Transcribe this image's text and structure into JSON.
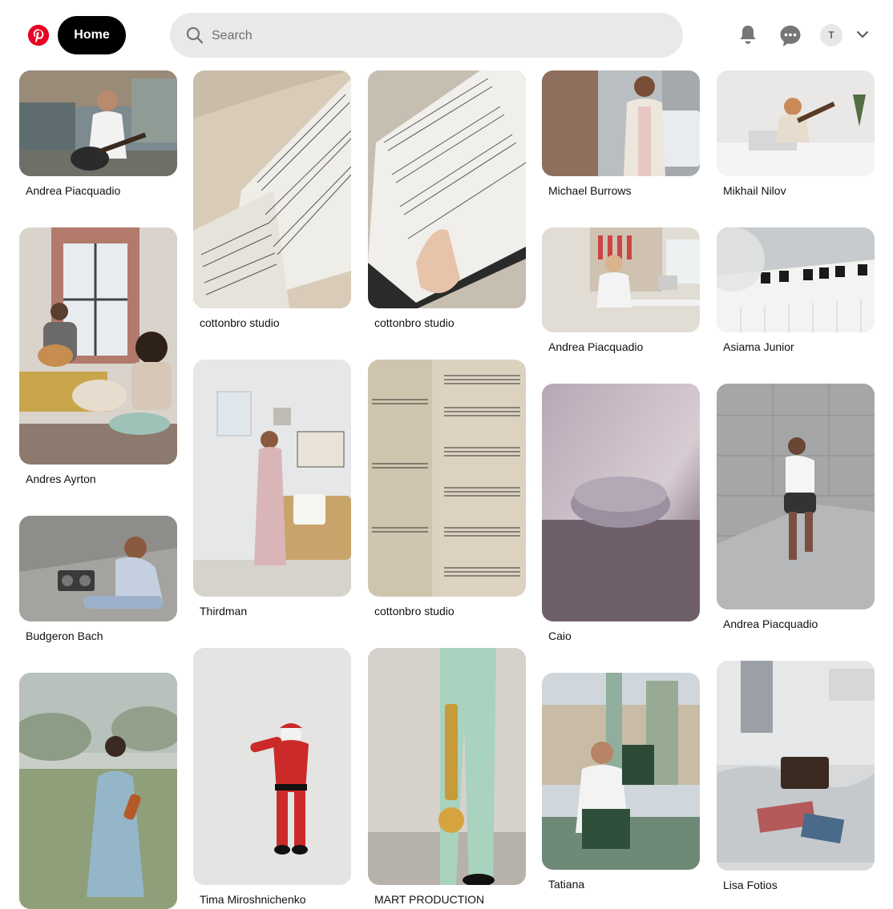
{
  "header": {
    "home_label": "Home",
    "search_placeholder": "Search",
    "avatar_initial": "T",
    "icons": {
      "logo": "pinterest-logo-icon",
      "search": "search-icon",
      "notifications": "bell-icon",
      "messages": "chat-icon",
      "account_menu": "chevron-down-icon"
    },
    "brand_color": "#e60023"
  },
  "pins": [
    {
      "author": "Andrea Piacquadio",
      "scene": "man playing guitar on city rooftop"
    },
    {
      "author": "cottonbro studio",
      "scene": "open hymn book with sheet music"
    },
    {
      "author": "cottonbro studio",
      "scene": "hand holding a music book"
    },
    {
      "author": "Michael Burrows",
      "scene": "man walking on city street"
    },
    {
      "author": "Mikhail Nilov",
      "scene": "boy playing ukulele on bed"
    },
    {
      "author": "Andres Ayrton",
      "scene": "man with guitar and woman with dog"
    },
    {
      "author": "Andrea Piacquadio",
      "scene": "woman with headphones at desk"
    },
    {
      "author": "Asiama Junior",
      "scene": "piano keys with flowers"
    },
    {
      "author": "Thirdman",
      "scene": "woman dancing in living room"
    },
    {
      "author": "cottonbro studio",
      "scene": "page of musical notes"
    },
    {
      "author": "Caio",
      "scene": "smart speaker on table"
    },
    {
      "author": "Andrea Piacquadio",
      "scene": "man exercising on stairs"
    },
    {
      "author": "Budgeron Bach",
      "scene": "person with boombox on pavement"
    },
    {
      "author": "Tima Miroshnichenko",
      "scene": "dancing santa with headphones"
    },
    {
      "author": "MART PRODUCTION",
      "scene": "person holding a trumpet"
    },
    {
      "author": "Tatiana",
      "scene": "bagpiper in London"
    },
    {
      "author": "Lisa Fotios",
      "scene": "record player on bed"
    },
    {
      "author": "",
      "scene": "girl with violin in field"
    }
  ]
}
